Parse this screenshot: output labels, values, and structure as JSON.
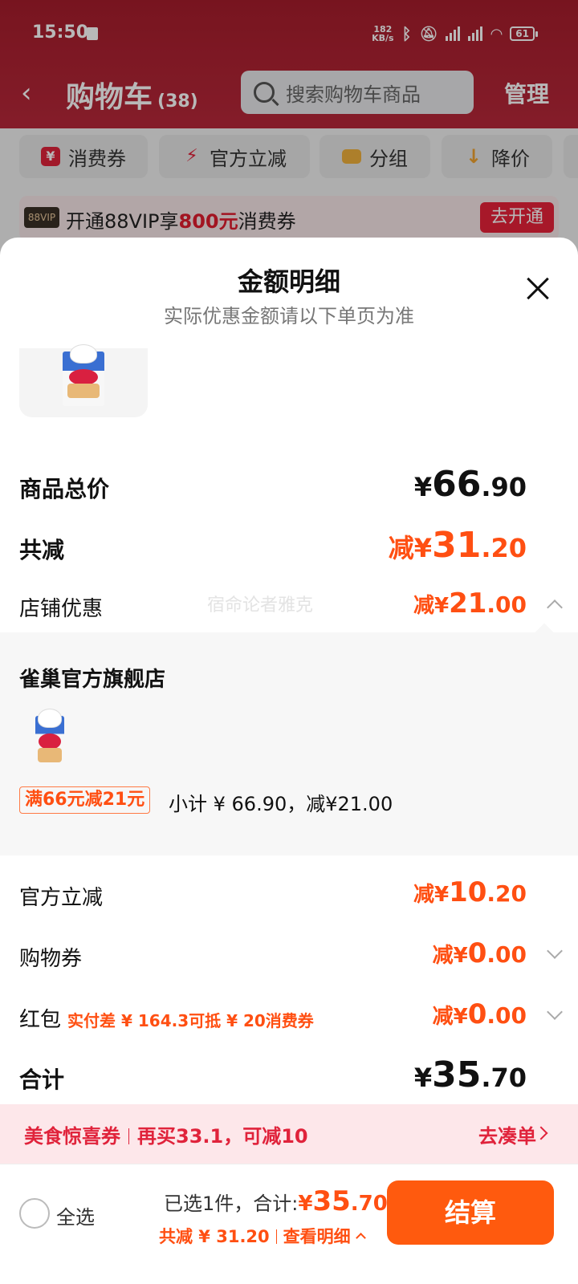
{
  "status_bar": {
    "time": "15:50",
    "net_speed_value": "182",
    "net_speed_unit": "KB/s",
    "battery": "61"
  },
  "nav": {
    "back_glyph": "‹",
    "title": "购物车",
    "count": "(38)",
    "search_placeholder": "搜索购物车商品",
    "manage": "管理"
  },
  "chips": [
    {
      "label": "消费券",
      "icon": "coupon-icon",
      "icon_glyph": "¥",
      "color": "#e0233b"
    },
    {
      "label": "官方立减",
      "icon": "lightning-icon",
      "icon_glyph": "⚡",
      "color": "#e0233b"
    },
    {
      "label": "分组",
      "icon": "folder-icon",
      "icon_glyph": "▬",
      "color": "#f0b13c"
    },
    {
      "label": "降价",
      "icon": "down-arrow-icon",
      "icon_glyph": "↓",
      "color": "#f0a330"
    }
  ],
  "vip_bar": {
    "badge": "88VIP",
    "text_pre": "开通88VIP享",
    "text_amount": "800元",
    "text_post": "消费券",
    "button": "去开通"
  },
  "sheet": {
    "title": "金额明细",
    "subtitle": "实际优惠金额请以下单页为准",
    "total_price": {
      "label": "商品总价",
      "yen": "¥",
      "int": "66",
      "dec": ".90"
    },
    "total_discount": {
      "label": "共减",
      "prefix": "减¥",
      "int": "31",
      "dec": ".20"
    },
    "shop_discount": {
      "label": "店铺优惠",
      "prefix": "减¥",
      "int": "21",
      "dec": ".00"
    },
    "watermark": "宿命论者雅克",
    "shop": {
      "name": "雀巢官方旗舰店",
      "promo": "满66元减21元",
      "subtotal": "小计 ¥ 66.90，减¥21.00"
    },
    "official_discount": {
      "label": "官方立减",
      "prefix": "减¥",
      "int": "10",
      "dec": ".20"
    },
    "shopping_coupon": {
      "label": "购物券",
      "prefix": "减¥",
      "int": "0",
      "dec": ".00"
    },
    "red_packet": {
      "label": "红包",
      "reminder": "实付差 ¥ 164.3可抵 ¥ 20消费券",
      "prefix": "减¥",
      "int": "0",
      "dec": ".00"
    },
    "grand_total": {
      "label": "合计",
      "yen": "¥",
      "int": "35",
      "dec": ".70"
    }
  },
  "coupon_bar": {
    "name": "美食惊喜券",
    "hint": "再买33.1，可减10",
    "action": "去凑单"
  },
  "bottom_bar": {
    "select_all": "全选",
    "selected_text": "已选1件，合计:",
    "total_yen": "¥",
    "total_int": "35",
    "total_dec": ".70",
    "discount_text": "共减 ¥ 31.20",
    "detail_link": "查看明细",
    "checkout": "结算"
  }
}
